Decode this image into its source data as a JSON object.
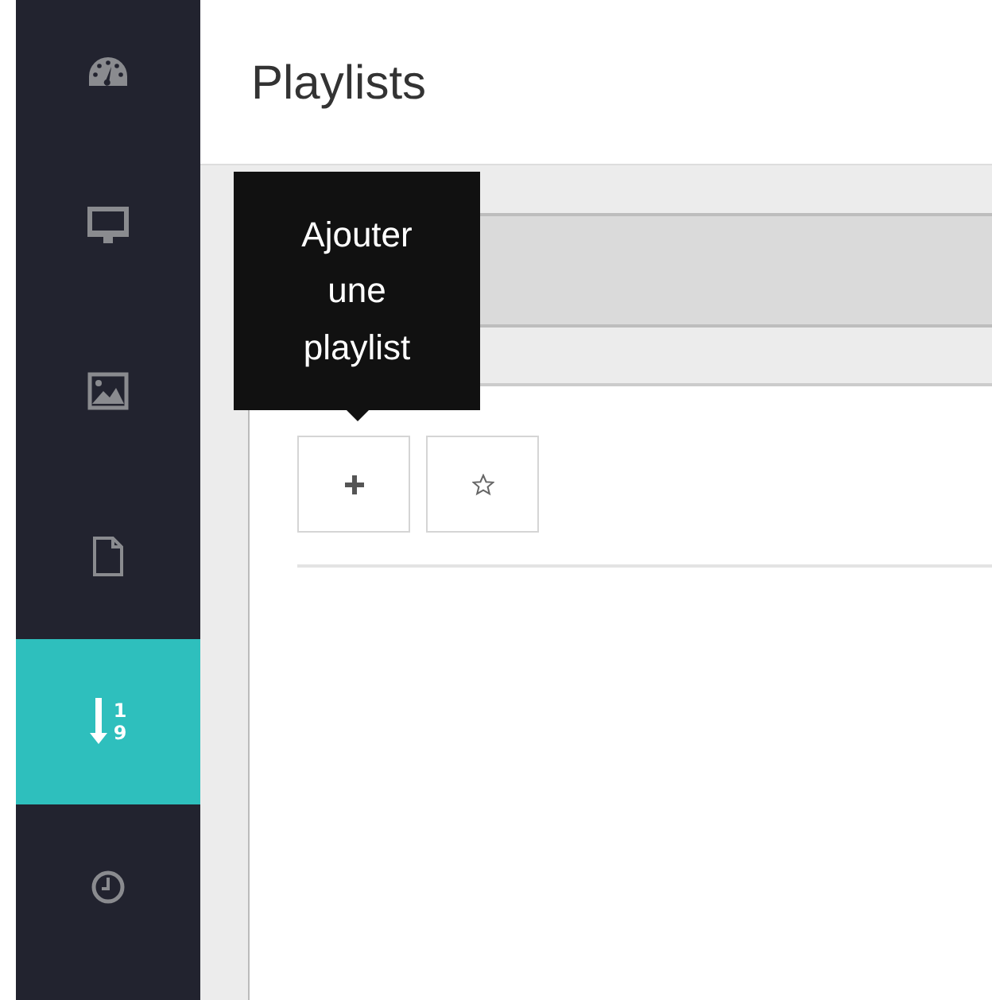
{
  "sidebar": {
    "items": [
      {
        "selected": false
      },
      {
        "selected": false
      },
      {
        "selected": false
      },
      {
        "selected": false
      },
      {
        "selected": true,
        "digits": [
          "1",
          "9"
        ]
      },
      {
        "selected": false
      }
    ]
  },
  "page_title": "Playlists",
  "tooltip": {
    "text": "Ajouter une playlist"
  }
}
